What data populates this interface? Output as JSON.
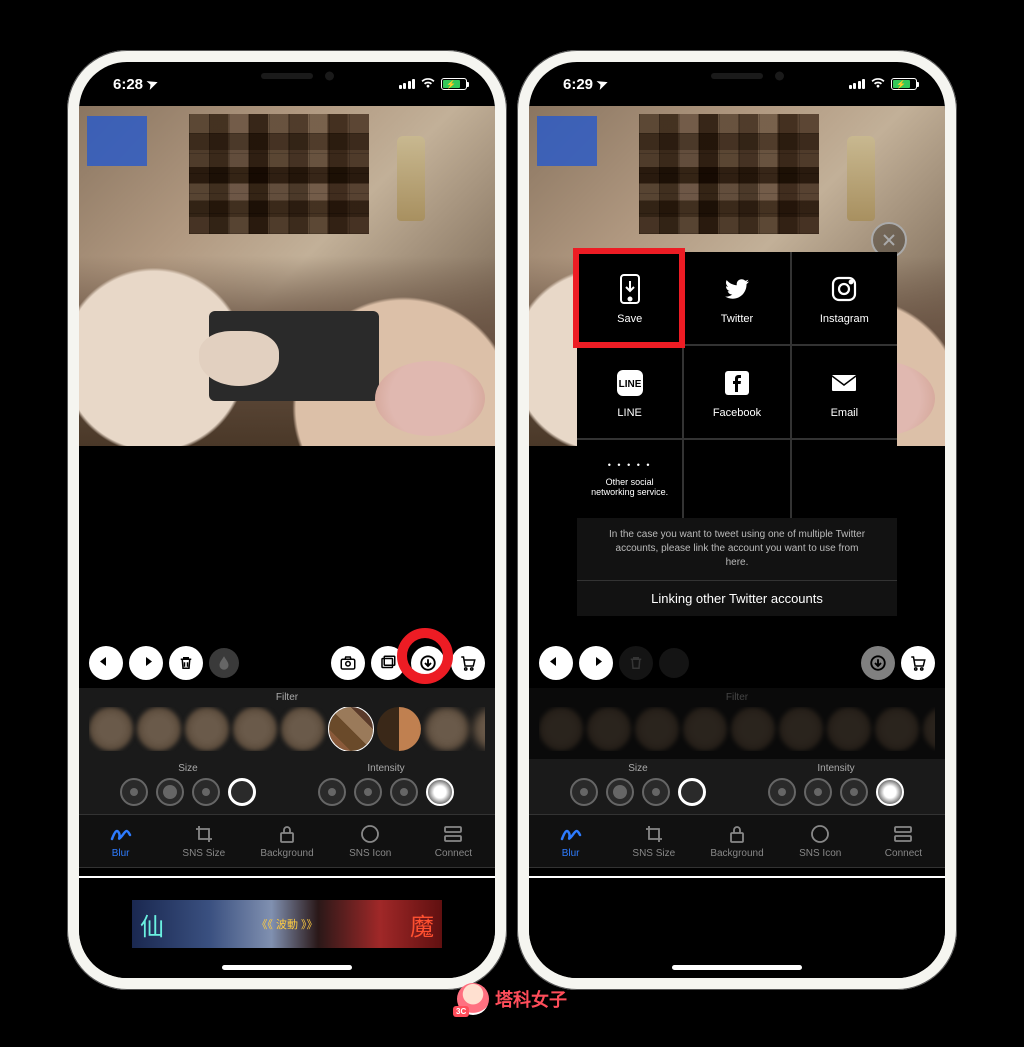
{
  "status": {
    "time_left": "6:28",
    "time_right": "6:29",
    "location_icon": "➤"
  },
  "editor": {
    "filter_label": "Filter",
    "size_label": "Size",
    "intensity_label": "Intensity"
  },
  "tabs": [
    {
      "id": "blur",
      "label": "Blur",
      "active": true
    },
    {
      "id": "sns-size",
      "label": "SNS Size",
      "active": false
    },
    {
      "id": "background",
      "label": "Background",
      "active": false
    },
    {
      "id": "sns-icon",
      "label": "SNS Icon",
      "active": false
    },
    {
      "id": "connect",
      "label": "Connect",
      "active": false
    }
  ],
  "ad": {
    "char_left": "仙",
    "char_right": "魔",
    "mid": "《《 波動 》》"
  },
  "share": {
    "items": [
      {
        "id": "save",
        "label": "Save"
      },
      {
        "id": "twitter",
        "label": "Twitter"
      },
      {
        "id": "instagram",
        "label": "Instagram"
      },
      {
        "id": "line",
        "label": "LINE"
      },
      {
        "id": "facebook",
        "label": "Facebook"
      },
      {
        "id": "email",
        "label": "Email"
      }
    ],
    "other_dots": "• • • • •",
    "other_label": "Other social\nnetworking service.",
    "footer_note": "In the case you want to tweet using one of multiple Twitter accounts, please link the account you want to use from here.",
    "link_label": "Linking other Twitter accounts"
  },
  "watermark": "塔科女子",
  "watermark_badge": "3C"
}
